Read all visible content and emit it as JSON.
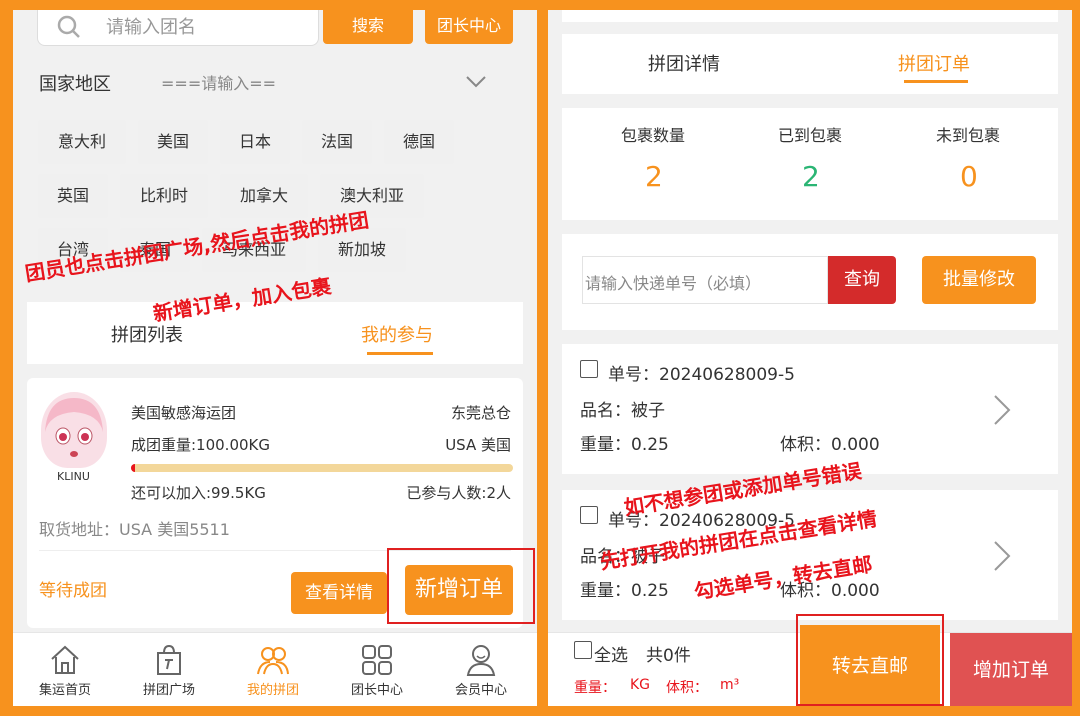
{
  "left": {
    "search": {
      "placeholder": "请输入团名",
      "search_label": "搜索",
      "leader_label": "团长中心"
    },
    "country": {
      "label": "国家地区",
      "placeholder": "===请输入=="
    },
    "countries": [
      "意大利",
      "美国",
      "日本",
      "法国",
      "德国",
      "英国",
      "比利时",
      "加拿大",
      "澳大利亚",
      "台湾",
      "泰国",
      "马来西亚",
      "新加坡"
    ],
    "tabs": {
      "list": "拼团列表",
      "mine": "我的参与"
    },
    "group": {
      "avatar_label": "KLINU",
      "name": "美国敏感海运团",
      "warehouse": "东莞总仓",
      "weight": "成团重量:100.00KG",
      "dest": "USA 美国",
      "progress_pct": 1,
      "remaining": "还可以加入:99.5KG",
      "joined": "已参与人数:2人",
      "address": "取货地址：USA 美国5511",
      "status": "等待成团",
      "detail_label": "查看详情",
      "add_order_label": "新增订单"
    },
    "nav": [
      "集运首页",
      "拼团广场",
      "我的拼团",
      "团长中心",
      "会员中心"
    ],
    "annotation": [
      "团员也点击拼团广场,然后点击我的拼团",
      "新增订单，加入包裹"
    ]
  },
  "right": {
    "tabs": {
      "detail": "拼团详情",
      "orders": "拼团订单"
    },
    "stats": [
      {
        "label": "包裹数量",
        "value": "2",
        "color": "#f7921e"
      },
      {
        "label": "已到包裹",
        "value": "2",
        "color": "#2bb574"
      },
      {
        "label": "未到包裹",
        "value": "0",
        "color": "#f7921e"
      }
    ],
    "query": {
      "placeholder": "请输入快递单号（必填）",
      "query_label": "查询",
      "batch_label": "批量修改"
    },
    "orders": [
      {
        "no": "单号：20240628009-5",
        "item": "品名：被子",
        "weight": "重量：0.25",
        "volume": "体积：0.000"
      },
      {
        "no": "单号：20240628009-5",
        "item": "品名：被子",
        "weight": "重量：0.25",
        "volume": "体积：0.000"
      }
    ],
    "footer": {
      "select_all": "全选",
      "count": "共0件",
      "weight_label": "重量：",
      "weight_unit": "KG",
      "volume_label": "体积：",
      "volume_unit": "m³",
      "direct_label": "转去直邮",
      "add_label": "增加订单"
    },
    "annotation": [
      "如不想参团或添加单号错误",
      "先打开我的拼团在点击查看详情",
      "勾选单号，转去直邮"
    ]
  }
}
